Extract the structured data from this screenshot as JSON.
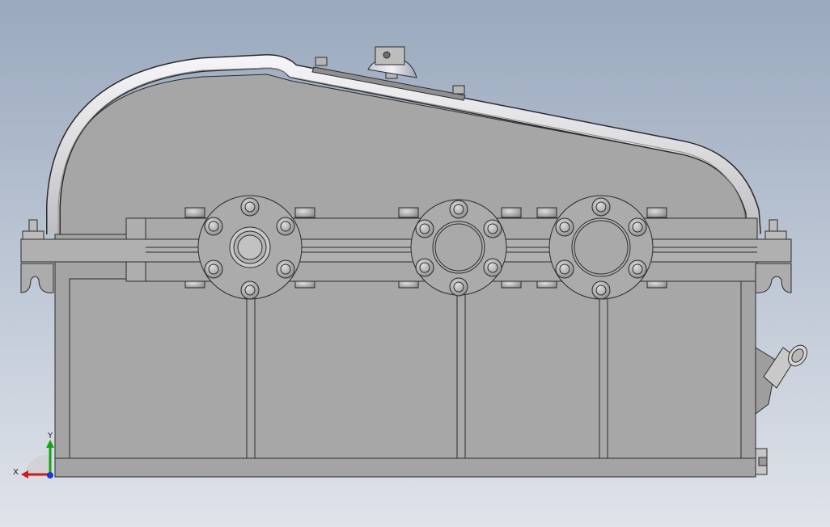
{
  "viewport": {
    "background_top": "#9aa9be",
    "background_bottom": "#dfe3ea"
  },
  "model": {
    "body_color": "#a4a4a4",
    "flange_color": "#ababab",
    "tube_color": "#e8e8ea",
    "bolt_color": "#b9b9b9",
    "edge_color": "#2b2b2b",
    "bearing_housings": 3,
    "bolts_per_flange": 6
  },
  "triad": {
    "x_label": "X",
    "y_label": "Y",
    "x_color": "#d21919",
    "y_color": "#17a317",
    "z_color": "#1a3ad6"
  }
}
